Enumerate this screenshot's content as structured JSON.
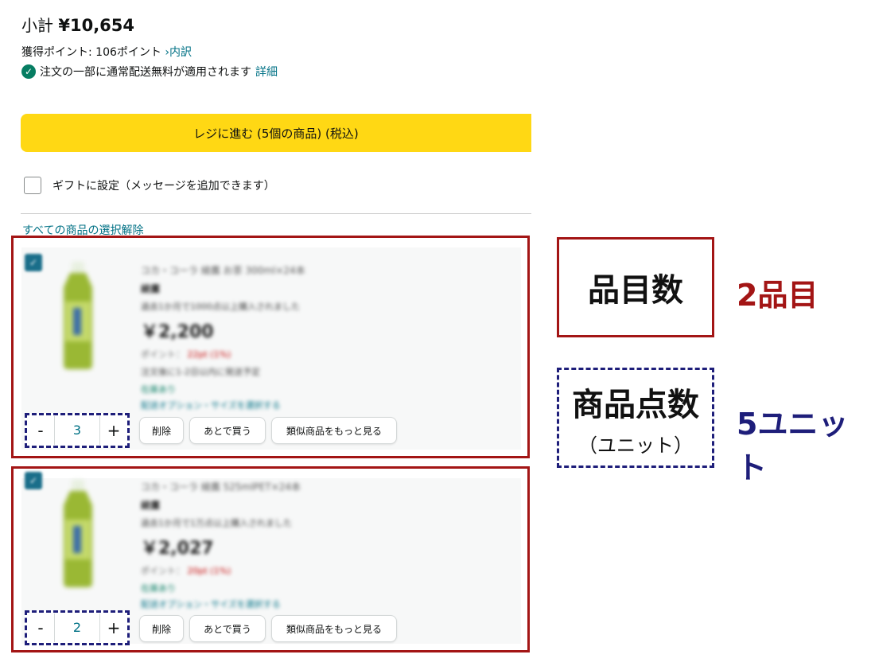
{
  "summary": {
    "subtotal_label": "小計",
    "subtotal_amount": "¥10,654",
    "points_text": "獲得ポイント: 106ポイント",
    "points_link": "›内訳",
    "shipping_text": "注文の一部に通常配送無料が適用されます",
    "shipping_link": "詳細",
    "checkout_button": "レジに進む (5個の商品) (税込)",
    "gift_label": "ギフトに設定（メッセージを追加できます）",
    "deselect_all": "すべての商品の選択解除"
  },
  "items": [
    {
      "title": "コカ・コーラ 綾鷹 お茶 300ml×24本",
      "sub": "綾鷹",
      "note": "過去1か月で1000点以上購入されました",
      "price": "￥2,200",
      "points": "ポイント：",
      "points_red": "22pt (1%)",
      "delivery_note": "注文後に1-2日以内に発送予定",
      "in_stock": "在庫あり",
      "link": "配送オプション・サイズを選択する",
      "qty": "3",
      "minus": "-",
      "plus": "+",
      "delete": "削除",
      "save_later": "あとで買う",
      "similar": "類似商品をもっと見る"
    },
    {
      "title": "コカ・コーラ 綾鷹 525mlPET×24本",
      "sub": "綾鷹",
      "note": "過去1か月で1万点以上購入されました",
      "price": "￥2,027",
      "points": "ポイント：",
      "points_red": "20pt (1%)",
      "delivery_note": "",
      "in_stock": "在庫あり",
      "link": "配送オプション・サイズを選択する",
      "qty": "2",
      "minus": "-",
      "plus": "+",
      "delete": "削除",
      "save_later": "あとで買う",
      "similar": "類似商品をもっと見る"
    }
  ],
  "legend": {
    "item_types_label": "品目数",
    "item_types_value": "2品目",
    "units_label": "商品点数",
    "units_sub": "（ユニット）",
    "units_value": "5ユニット"
  },
  "colors": {
    "checkout": "#ffd814",
    "highlight_red": "#a31515",
    "highlight_blue": "#1e1e7a",
    "link": "#007185"
  },
  "icons": [
    "check-circle-icon",
    "checkbox-icon",
    "bottle-image"
  ]
}
